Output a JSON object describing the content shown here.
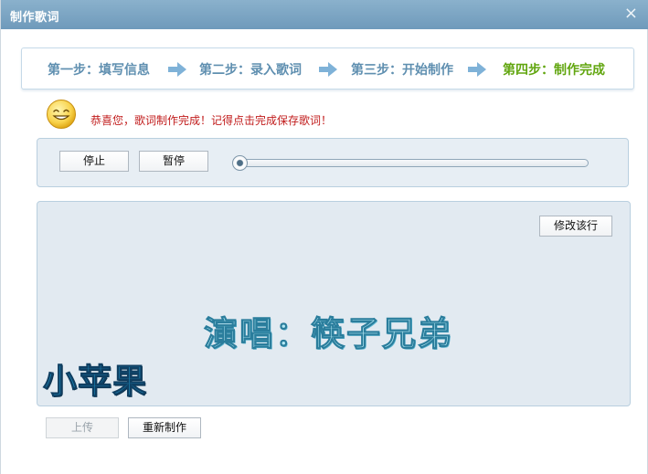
{
  "window": {
    "title": "制作歌词",
    "close_glyph": "×"
  },
  "steps": [
    {
      "label": "第一步：填写信息",
      "active": false
    },
    {
      "label": "第二步：录入歌词",
      "active": false
    },
    {
      "label": "第三步：开始制作",
      "active": false
    },
    {
      "label": "第四步：制作完成",
      "active": true
    }
  ],
  "status": {
    "icon": "smiley-icon",
    "message": "恭喜您，歌词制作完成！记得点击完成保存歌词！"
  },
  "controls": {
    "stop_label": "停止",
    "pause_label": "暂停",
    "progress": 0
  },
  "display": {
    "edit_line_label": "修改该行",
    "artist_line": "演唱：筷子兄弟",
    "title_line": "小苹果"
  },
  "footer": {
    "upload_label": "上传",
    "upload_enabled": false,
    "remake_label": "重新制作"
  },
  "colors": {
    "step_inactive": "#5f8fb0",
    "step_active": "#62a610",
    "message": "#c11b1b",
    "titlebar": "#7ea6c4"
  }
}
